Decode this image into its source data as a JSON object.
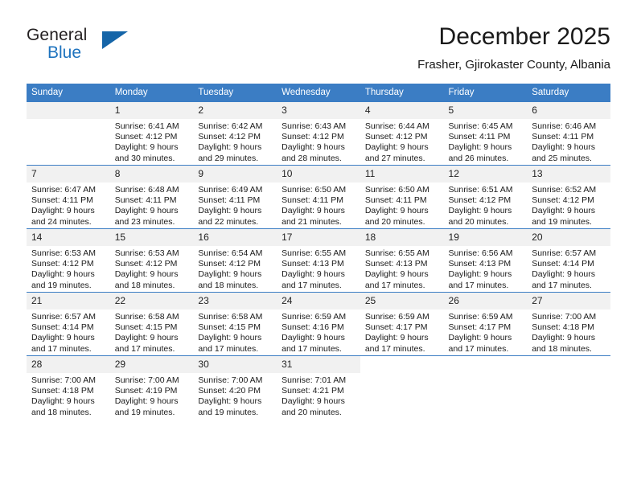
{
  "brand": {
    "name_part1": "General",
    "name_part2": "Blue",
    "logo_icon": "blue-triangle-logo"
  },
  "header": {
    "title": "December 2025",
    "subtitle": "Frasher, Gjirokaster County, Albania"
  },
  "colors": {
    "header_blue": "#3b7dc4",
    "brand_blue": "#1e73be",
    "daynum_bg": "#f1f1f1",
    "text": "#1a1a1a"
  },
  "calendar": {
    "weekday_headers": [
      "Sunday",
      "Monday",
      "Tuesday",
      "Wednesday",
      "Thursday",
      "Friday",
      "Saturday"
    ],
    "weeks": [
      [
        {
          "day": "",
          "blank": true,
          "sunrise": "",
          "sunset": "",
          "daylight_line1": "",
          "daylight_line2": ""
        },
        {
          "day": "1",
          "sunrise": "Sunrise: 6:41 AM",
          "sunset": "Sunset: 4:12 PM",
          "daylight_line1": "Daylight: 9 hours",
          "daylight_line2": "and 30 minutes."
        },
        {
          "day": "2",
          "sunrise": "Sunrise: 6:42 AM",
          "sunset": "Sunset: 4:12 PM",
          "daylight_line1": "Daylight: 9 hours",
          "daylight_line2": "and 29 minutes."
        },
        {
          "day": "3",
          "sunrise": "Sunrise: 6:43 AM",
          "sunset": "Sunset: 4:12 PM",
          "daylight_line1": "Daylight: 9 hours",
          "daylight_line2": "and 28 minutes."
        },
        {
          "day": "4",
          "sunrise": "Sunrise: 6:44 AM",
          "sunset": "Sunset: 4:12 PM",
          "daylight_line1": "Daylight: 9 hours",
          "daylight_line2": "and 27 minutes."
        },
        {
          "day": "5",
          "sunrise": "Sunrise: 6:45 AM",
          "sunset": "Sunset: 4:11 PM",
          "daylight_line1": "Daylight: 9 hours",
          "daylight_line2": "and 26 minutes."
        },
        {
          "day": "6",
          "sunrise": "Sunrise: 6:46 AM",
          "sunset": "Sunset: 4:11 PM",
          "daylight_line1": "Daylight: 9 hours",
          "daylight_line2": "and 25 minutes."
        }
      ],
      [
        {
          "day": "7",
          "sunrise": "Sunrise: 6:47 AM",
          "sunset": "Sunset: 4:11 PM",
          "daylight_line1": "Daylight: 9 hours",
          "daylight_line2": "and 24 minutes."
        },
        {
          "day": "8",
          "sunrise": "Sunrise: 6:48 AM",
          "sunset": "Sunset: 4:11 PM",
          "daylight_line1": "Daylight: 9 hours",
          "daylight_line2": "and 23 minutes."
        },
        {
          "day": "9",
          "sunrise": "Sunrise: 6:49 AM",
          "sunset": "Sunset: 4:11 PM",
          "daylight_line1": "Daylight: 9 hours",
          "daylight_line2": "and 22 minutes."
        },
        {
          "day": "10",
          "sunrise": "Sunrise: 6:50 AM",
          "sunset": "Sunset: 4:11 PM",
          "daylight_line1": "Daylight: 9 hours",
          "daylight_line2": "and 21 minutes."
        },
        {
          "day": "11",
          "sunrise": "Sunrise: 6:50 AM",
          "sunset": "Sunset: 4:11 PM",
          "daylight_line1": "Daylight: 9 hours",
          "daylight_line2": "and 20 minutes."
        },
        {
          "day": "12",
          "sunrise": "Sunrise: 6:51 AM",
          "sunset": "Sunset: 4:12 PM",
          "daylight_line1": "Daylight: 9 hours",
          "daylight_line2": "and 20 minutes."
        },
        {
          "day": "13",
          "sunrise": "Sunrise: 6:52 AM",
          "sunset": "Sunset: 4:12 PM",
          "daylight_line1": "Daylight: 9 hours",
          "daylight_line2": "and 19 minutes."
        }
      ],
      [
        {
          "day": "14",
          "sunrise": "Sunrise: 6:53 AM",
          "sunset": "Sunset: 4:12 PM",
          "daylight_line1": "Daylight: 9 hours",
          "daylight_line2": "and 19 minutes."
        },
        {
          "day": "15",
          "sunrise": "Sunrise: 6:53 AM",
          "sunset": "Sunset: 4:12 PM",
          "daylight_line1": "Daylight: 9 hours",
          "daylight_line2": "and 18 minutes."
        },
        {
          "day": "16",
          "sunrise": "Sunrise: 6:54 AM",
          "sunset": "Sunset: 4:12 PM",
          "daylight_line1": "Daylight: 9 hours",
          "daylight_line2": "and 18 minutes."
        },
        {
          "day": "17",
          "sunrise": "Sunrise: 6:55 AM",
          "sunset": "Sunset: 4:13 PM",
          "daylight_line1": "Daylight: 9 hours",
          "daylight_line2": "and 17 minutes."
        },
        {
          "day": "18",
          "sunrise": "Sunrise: 6:55 AM",
          "sunset": "Sunset: 4:13 PM",
          "daylight_line1": "Daylight: 9 hours",
          "daylight_line2": "and 17 minutes."
        },
        {
          "day": "19",
          "sunrise": "Sunrise: 6:56 AM",
          "sunset": "Sunset: 4:13 PM",
          "daylight_line1": "Daylight: 9 hours",
          "daylight_line2": "and 17 minutes."
        },
        {
          "day": "20",
          "sunrise": "Sunrise: 6:57 AM",
          "sunset": "Sunset: 4:14 PM",
          "daylight_line1": "Daylight: 9 hours",
          "daylight_line2": "and 17 minutes."
        }
      ],
      [
        {
          "day": "21",
          "sunrise": "Sunrise: 6:57 AM",
          "sunset": "Sunset: 4:14 PM",
          "daylight_line1": "Daylight: 9 hours",
          "daylight_line2": "and 17 minutes."
        },
        {
          "day": "22",
          "sunrise": "Sunrise: 6:58 AM",
          "sunset": "Sunset: 4:15 PM",
          "daylight_line1": "Daylight: 9 hours",
          "daylight_line2": "and 17 minutes."
        },
        {
          "day": "23",
          "sunrise": "Sunrise: 6:58 AM",
          "sunset": "Sunset: 4:15 PM",
          "daylight_line1": "Daylight: 9 hours",
          "daylight_line2": "and 17 minutes."
        },
        {
          "day": "24",
          "sunrise": "Sunrise: 6:59 AM",
          "sunset": "Sunset: 4:16 PM",
          "daylight_line1": "Daylight: 9 hours",
          "daylight_line2": "and 17 minutes."
        },
        {
          "day": "25",
          "sunrise": "Sunrise: 6:59 AM",
          "sunset": "Sunset: 4:17 PM",
          "daylight_line1": "Daylight: 9 hours",
          "daylight_line2": "and 17 minutes."
        },
        {
          "day": "26",
          "sunrise": "Sunrise: 6:59 AM",
          "sunset": "Sunset: 4:17 PM",
          "daylight_line1": "Daylight: 9 hours",
          "daylight_line2": "and 17 minutes."
        },
        {
          "day": "27",
          "sunrise": "Sunrise: 7:00 AM",
          "sunset": "Sunset: 4:18 PM",
          "daylight_line1": "Daylight: 9 hours",
          "daylight_line2": "and 18 minutes."
        }
      ],
      [
        {
          "day": "28",
          "sunrise": "Sunrise: 7:00 AM",
          "sunset": "Sunset: 4:18 PM",
          "daylight_line1": "Daylight: 9 hours",
          "daylight_line2": "and 18 minutes."
        },
        {
          "day": "29",
          "sunrise": "Sunrise: 7:00 AM",
          "sunset": "Sunset: 4:19 PM",
          "daylight_line1": "Daylight: 9 hours",
          "daylight_line2": "and 19 minutes."
        },
        {
          "day": "30",
          "sunrise": "Sunrise: 7:00 AM",
          "sunset": "Sunset: 4:20 PM",
          "daylight_line1": "Daylight: 9 hours",
          "daylight_line2": "and 19 minutes."
        },
        {
          "day": "31",
          "sunrise": "Sunrise: 7:01 AM",
          "sunset": "Sunset: 4:21 PM",
          "daylight_line1": "Daylight: 9 hours",
          "daylight_line2": "and 20 minutes."
        },
        {
          "day": "",
          "trailing": true,
          "sunrise": "",
          "sunset": "",
          "daylight_line1": "",
          "daylight_line2": ""
        },
        {
          "day": "",
          "trailing": true,
          "sunrise": "",
          "sunset": "",
          "daylight_line1": "",
          "daylight_line2": ""
        },
        {
          "day": "",
          "trailing": true,
          "sunrise": "",
          "sunset": "",
          "daylight_line1": "",
          "daylight_line2": ""
        }
      ]
    ]
  }
}
